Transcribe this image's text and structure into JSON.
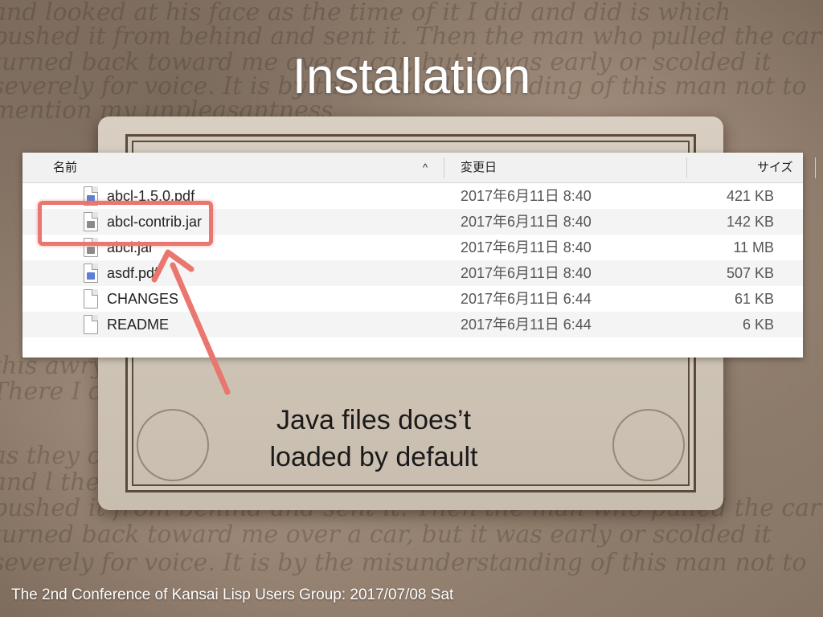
{
  "slide": {
    "title": "Installation",
    "note_line1": "Java files does’t",
    "note_line2": "loaded by default",
    "footer": "The 2nd Conference of Kansai Lisp Users Group: 2017/07/08 Sat"
  },
  "finder": {
    "columns": {
      "name": "名前",
      "date": "変更日",
      "size": "サイズ"
    },
    "sort_indicator": "^",
    "files": [
      {
        "name": "abcl-1.5.0.pdf",
        "date": "2017年6月11日 8:40",
        "size": "421 KB",
        "icon": "pdf-file-icon"
      },
      {
        "name": "abcl-contrib.jar",
        "date": "2017年6月11日 8:40",
        "size": "142 KB",
        "icon": "jar-file-icon"
      },
      {
        "name": "abcl.jar",
        "date": "2017年6月11日 8:40",
        "size": "11 MB",
        "icon": "jar-file-icon"
      },
      {
        "name": "asdf.pdf",
        "date": "2017年6月11日 8:40",
        "size": "507 KB",
        "icon": "pdf-file-icon"
      },
      {
        "name": "CHANGES",
        "date": "2017年6月11日 6:44",
        "size": "61 KB",
        "icon": "text-file-icon"
      },
      {
        "name": "README",
        "date": "2017年6月11日 6:44",
        "size": "6 KB",
        "icon": "text-file-icon"
      }
    ]
  },
  "colors": {
    "highlight": "#e9766f",
    "title_text": "#ffffff"
  }
}
